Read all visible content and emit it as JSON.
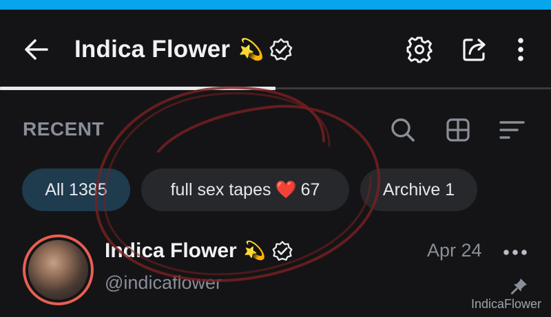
{
  "header": {
    "title": "Indica Flower",
    "title_emoji": "💫",
    "verified": true,
    "icons": [
      "arrow-left-icon",
      "verified-badge-icon",
      "gear-icon",
      "share-icon",
      "more-vertical-icon"
    ]
  },
  "section": {
    "label": "RECENT",
    "tools": [
      "search-icon",
      "grid-icon",
      "sort-icon"
    ]
  },
  "filters": [
    {
      "label": "All 1385",
      "active": true
    },
    {
      "label_before": "full sex tapes",
      "emoji": "❤️",
      "label_after": "67",
      "active": false
    },
    {
      "label": "Archive 1",
      "active": false
    }
  ],
  "post": {
    "name": "Indica Flower",
    "emoji": "💫",
    "handle": "@indicaflower",
    "date": "Apr 24",
    "pinned": true
  },
  "watermark": "IndicaFlower",
  "colors": {
    "status_strip": "#08a4ec",
    "background": "#141416",
    "chip": "#26282c",
    "chip_active": "#1f3b4e",
    "muted_text": "#8a8e98",
    "avatar_ring": "#e85f52",
    "annotation_circle": "#7a1f20"
  }
}
